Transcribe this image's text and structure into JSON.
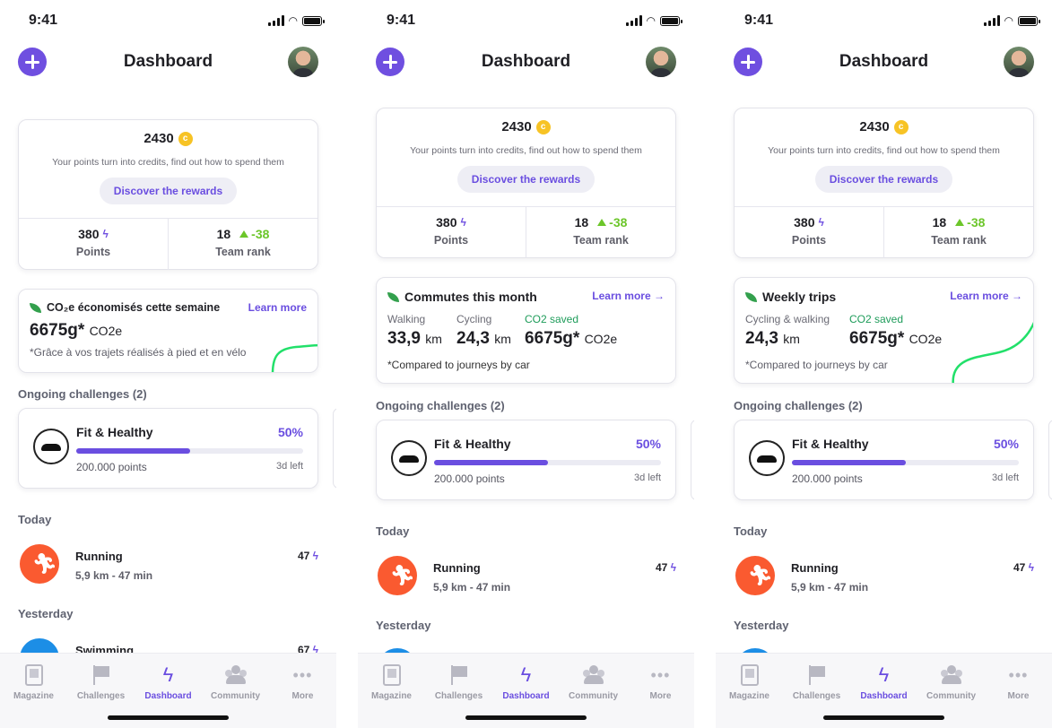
{
  "status": {
    "time": "9:41"
  },
  "header": {
    "title": "Dashboard"
  },
  "points": {
    "total": "2430",
    "coin_symbol": "c",
    "subtitle": "Your points turn into credits, find out how to spend them",
    "rewards_label": "Discover the rewards",
    "points_value": "380",
    "points_label": "Points",
    "rank_value": "18",
    "rank_delta": "-38",
    "rank_label": "Team rank",
    "bolt": "ϟ"
  },
  "screen1": {
    "co2_title": "CO₂e économisés cette semaine",
    "learn_more": "Learn more",
    "co2_value": "6675g*",
    "co2_unit": "CO2e",
    "co2_note": "*Grâce à vos trajets réalisés à pied et en vélo"
  },
  "screen2": {
    "title": "Commutes this month",
    "learn_more": "Learn more →",
    "walking_label": "Walking",
    "walking_value": "33,9",
    "cycling_label": "Cycling",
    "cycling_value": "24,3",
    "km": "km",
    "saved_label": "CO2 saved",
    "saved_value": "6675g*",
    "saved_unit": "CO2e",
    "note": "*Compared to journeys by car"
  },
  "screen3": {
    "title": "Weekly trips",
    "learn_more": "Learn more →",
    "cw_label": "Cycling & walking",
    "cw_value": "24,3",
    "km": "km",
    "saved_label": "CO2 saved",
    "saved_value": "6675g*",
    "saved_unit": "CO2e",
    "note": "*Compared to journeys by car"
  },
  "challenges": {
    "section_label": "Ongoing challenges (2)",
    "name": "Fit & Healthy",
    "percent_label": "50%",
    "progress": 0.5,
    "points": "200.000 points",
    "time_left": "3d left"
  },
  "activity": {
    "today_label": "Today",
    "yesterday_label": "Yesterday",
    "running": {
      "name": "Running",
      "meta": "5,9 km  -  47 min",
      "points": "47"
    },
    "swimming": {
      "name": "Swimming",
      "points": "67"
    }
  },
  "tabs": [
    {
      "label": "Magazine",
      "icon": "magazine-icon"
    },
    {
      "label": "Challenges",
      "icon": "flag-icon"
    },
    {
      "label": "Dashboard",
      "icon": "bolt-icon"
    },
    {
      "label": "Community",
      "icon": "community-icon"
    },
    {
      "label": "More",
      "icon": "more-icon"
    }
  ],
  "colors": {
    "accent": "#6a4ee0",
    "green": "#6cc62a",
    "orange": "#fa5a30",
    "coin": "#f7c325"
  }
}
